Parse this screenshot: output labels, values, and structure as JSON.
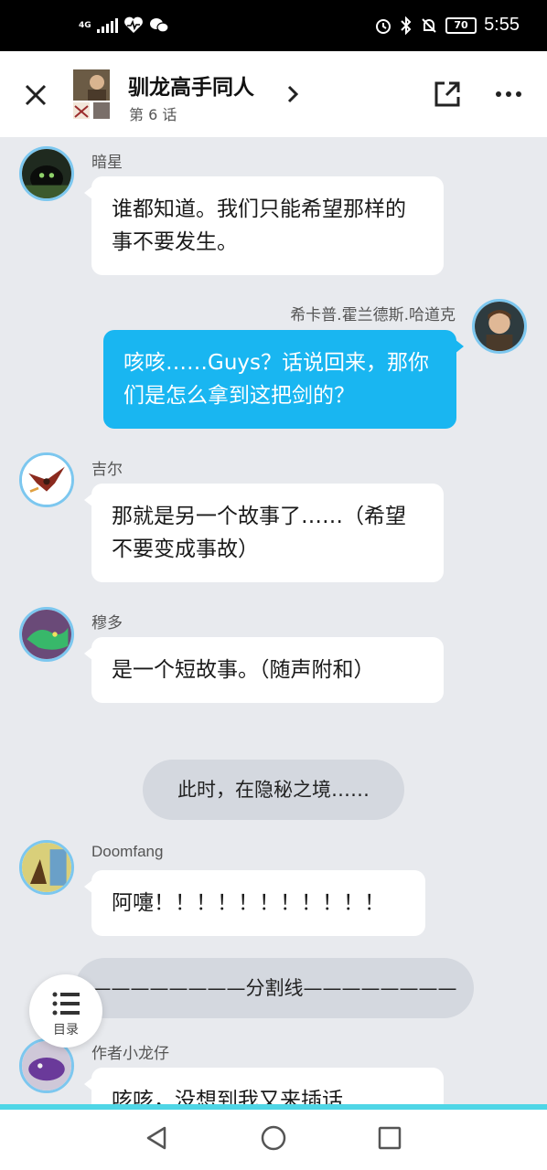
{
  "status_bar": {
    "network": "4G",
    "time": "5:55",
    "battery": "70"
  },
  "header": {
    "title": "驯龙高手同人",
    "subtitle": "第 6 话"
  },
  "messages": [
    {
      "speaker": "暗星",
      "text": "谁都知道。我们只能希望那样的事不要发生。"
    },
    {
      "speaker": "希卡普.霍兰德斯.哈道克",
      "text": "咳咳……Guys？话说回来，那你们是怎么拿到这把剑的？"
    },
    {
      "speaker": "吉尔",
      "text": "那就是另一个故事了……（希望不要变成事故）"
    },
    {
      "speaker": "穆多",
      "text": "是一个短故事。（随声附和）"
    },
    {
      "narration": "此时，在隐秘之境……"
    },
    {
      "speaker": "Doomfang",
      "text": "阿嚏！！！！！！！！！！！"
    },
    {
      "narration": "————————分割线————————"
    },
    {
      "speaker": "作者小龙仔",
      "text": "咳咳，没想到我又来插话"
    }
  ],
  "menu_button": {
    "label": "目录"
  },
  "colors": {
    "accent": "#19b6f1",
    "background": "#e8eaee",
    "nav_line": "#4fd6e6"
  },
  "icons": [
    "close-icon",
    "chevron-right-icon",
    "share-icon",
    "more-icon",
    "list-icon",
    "back-icon",
    "home-icon",
    "recents-icon"
  ]
}
